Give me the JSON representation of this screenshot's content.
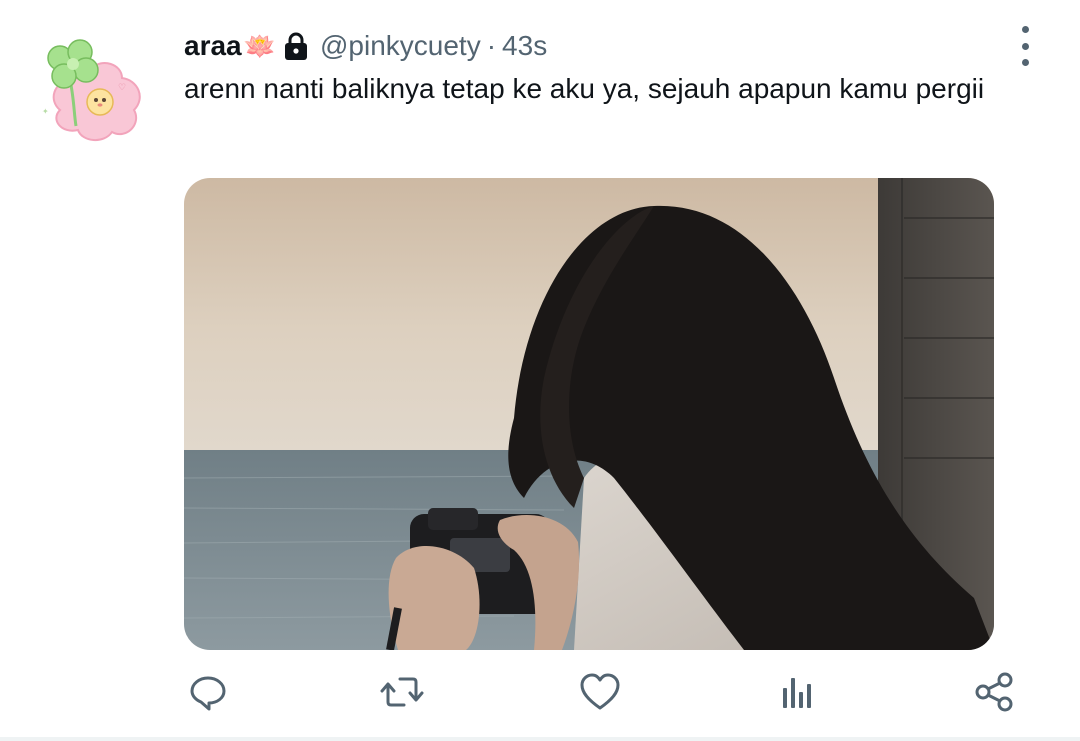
{
  "tweet": {
    "display_name": "araa",
    "name_emoji": "🪷",
    "handle": "@pinkycuety",
    "separator": "·",
    "time": "43s",
    "text": "arenn nanti baliknya tetap ke aku ya, sejauh apapun kamu pergii",
    "badges": {
      "protected": "lock-icon"
    },
    "media_description_icon": "photo"
  },
  "actions": {
    "reply": "reply-icon",
    "retweet": "retweet-icon",
    "like": "heart-icon",
    "analytics": "analytics-icon",
    "share": "share-icon"
  },
  "colors": {
    "text_primary": "#0f1419",
    "text_secondary": "#536471",
    "action_icon": "#536471"
  }
}
